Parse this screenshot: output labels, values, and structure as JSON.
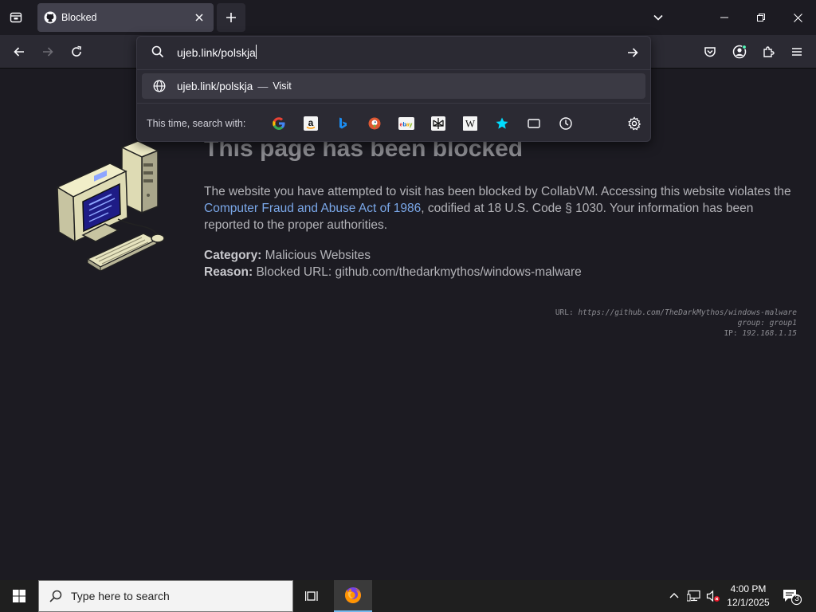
{
  "tab": {
    "title": "Blocked"
  },
  "url": {
    "value": "ujeb.link/polskja"
  },
  "suggestion": {
    "url": "ujeb.link/polskja",
    "dash": "—",
    "action": "Visit"
  },
  "search_with": {
    "label": "This time, search with:"
  },
  "engines": [
    "google",
    "amazon",
    "bing",
    "duckduckgo",
    "ebay",
    "perplexity",
    "wikipedia",
    "bookmarks",
    "tabs",
    "history"
  ],
  "page": {
    "heading": "This page has been blocked",
    "para_1": "The website you have attempted to visit has been blocked by CollabVM. Accessing this website violates the",
    "link": "Computer Fraud and Abuse Act of 1986",
    "para_2": ", codified at 18 U.S. Code § 1030. Your information has been reported to the proper authorities.",
    "category_label": "Category:",
    "category_value": "Malicious Websites",
    "reason_label": "Reason:",
    "reason_value": "Blocked URL: github.com/thedarkmythos/windows-malware",
    "tech_url_label": "URL:",
    "tech_url_value": "https://github.com/TheDarkMythos/windows-malware",
    "tech_group_label": "group:",
    "tech_group_value": "group1",
    "tech_ip_label": "IP:",
    "tech_ip_value": "192.168.1.15"
  },
  "taskbar": {
    "search_placeholder": "Type here to search",
    "time": "4:00 PM",
    "date": "12/1/2025",
    "notification_count": "3"
  },
  "colors": {
    "accent": "#76b9ed",
    "link": "#7aa7e8",
    "panel": "#2b2a33",
    "page_bg": "#1c1b22"
  }
}
